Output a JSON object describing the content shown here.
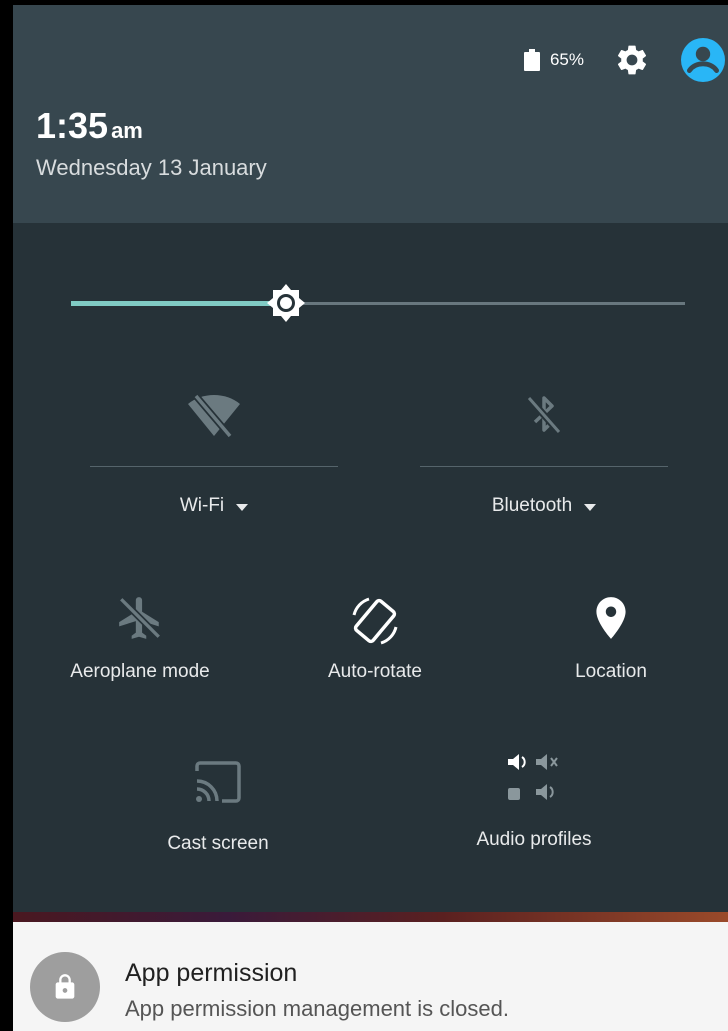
{
  "status_bar": {
    "battery_percent": "65%",
    "icons": [
      "battery-icon",
      "gear-icon",
      "account-icon"
    ]
  },
  "header": {
    "time": "1:35",
    "ampm": "am",
    "date": "Wednesday 13 January"
  },
  "brightness": {
    "level": 0.35,
    "icon": "brightness-icon"
  },
  "tiles": {
    "wifi": {
      "label": "Wi-Fi",
      "icon": "wifi-off-icon",
      "state": "off",
      "has_dropdown": true
    },
    "bluetooth": {
      "label": "Bluetooth",
      "icon": "bluetooth-off-icon",
      "state": "off",
      "has_dropdown": true
    },
    "aeroplane": {
      "label": "Aeroplane mode",
      "icon": "airplane-icon",
      "state": "off"
    },
    "autorotate": {
      "label": "Auto-rotate",
      "icon": "screen-rotation-icon",
      "state": "on"
    },
    "location": {
      "label": "Location",
      "icon": "location-pin-icon",
      "state": "on"
    },
    "cast": {
      "label": "Cast screen",
      "icon": "cast-icon",
      "state": "off"
    },
    "audio": {
      "label": "Audio profiles",
      "icon": "audio-profiles-icon",
      "state": "off"
    }
  },
  "notification": {
    "title": "App permission",
    "text": "App permission management is closed.",
    "icon": "lock-icon"
  },
  "colors": {
    "header_bg": "#37474f",
    "panel_bg": "#263238",
    "accent": "#80cbc4",
    "avatar": "#29b6f6"
  }
}
